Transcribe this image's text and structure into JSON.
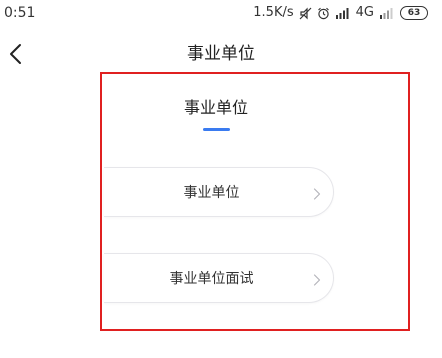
{
  "status_bar": {
    "time": "0:51",
    "network_speed": "1.5K/s",
    "network_type": "4G",
    "battery": "63",
    "icons": [
      "mute-icon",
      "alarm-icon",
      "signal-icon",
      "signal-icon-2"
    ]
  },
  "nav": {
    "title": "事业单位",
    "back_icon": "chevron-left-icon"
  },
  "section": {
    "title": "事业单位",
    "accent_color": "#3a7bf0",
    "highlight_color": "#e02020"
  },
  "items": [
    {
      "label": "事业单位",
      "icon": "chevron-right-icon"
    },
    {
      "label": "事业单位面试",
      "icon": "chevron-right-icon"
    }
  ]
}
